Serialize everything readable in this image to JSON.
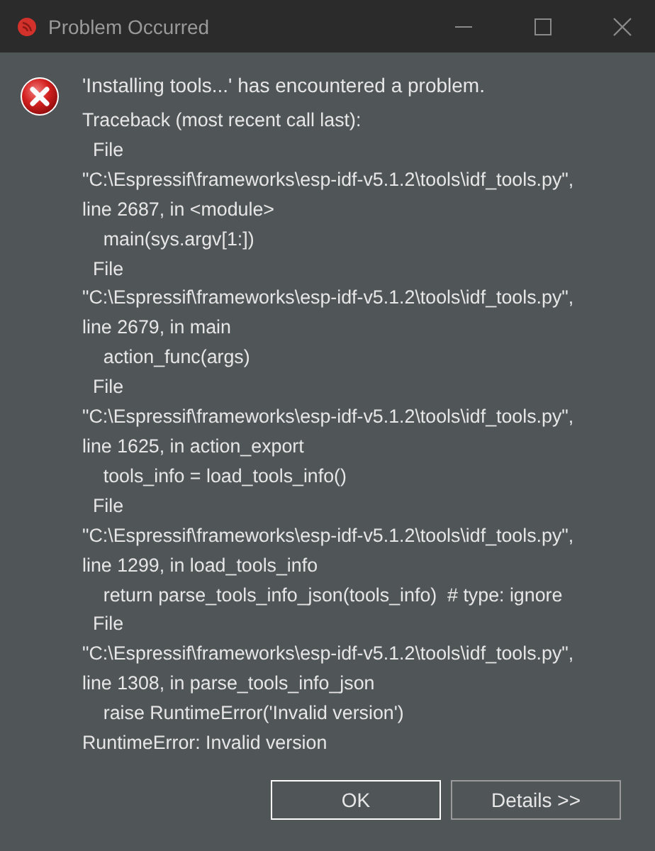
{
  "window": {
    "title": "Problem Occurred"
  },
  "message": "'Installing tools...' has encountered a problem.",
  "details": "Traceback (most recent call last):\n  File\n\"C:\\Espressif\\frameworks\\esp-idf-v5.1.2\\tools\\idf_tools.py\",\nline 2687, in <module>\n    main(sys.argv[1:])\n  File\n\"C:\\Espressif\\frameworks\\esp-idf-v5.1.2\\tools\\idf_tools.py\",\nline 2679, in main\n    action_func(args)\n  File\n\"C:\\Espressif\\frameworks\\esp-idf-v5.1.2\\tools\\idf_tools.py\",\nline 1625, in action_export\n    tools_info = load_tools_info()\n  File\n\"C:\\Espressif\\frameworks\\esp-idf-v5.1.2\\tools\\idf_tools.py\",\nline 1299, in load_tools_info\n    return parse_tools_info_json(tools_info)  # type: ignore\n  File\n\"C:\\Espressif\\frameworks\\esp-idf-v5.1.2\\tools\\idf_tools.py\",\nline 1308, in parse_tools_info_json\n    raise RuntimeError('Invalid version')\nRuntimeError: Invalid version",
  "buttons": [
    {
      "label": "OK",
      "selected": true
    },
    {
      "label": "Details >>",
      "selected": false
    }
  ]
}
